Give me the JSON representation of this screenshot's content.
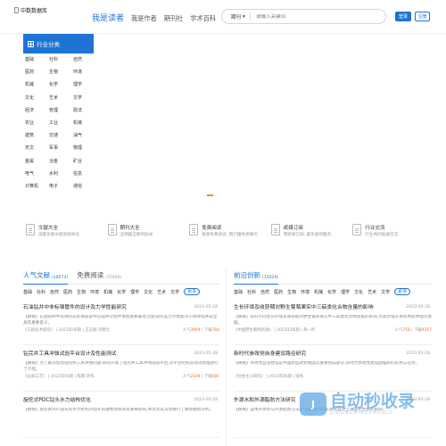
{
  "header": {
    "logo_text": "中数数据库",
    "nav": [
      "我是读者",
      "我是作者",
      "期刊社",
      "学术百科"
    ],
    "search_type": "期刊",
    "search_placeholder": "请输入关键词",
    "login": "登录",
    "register": "注册"
  },
  "categories": {
    "title": "行业分类",
    "items": [
      "基础",
      "社科",
      "自然",
      "医药",
      "生物",
      "环境",
      "机械",
      "化学",
      "理学",
      "文化",
      "艺术",
      "文学",
      "经济",
      "管理",
      "政法",
      "农业",
      "工业",
      "机械",
      "建筑",
      "交通",
      "油气",
      "天文",
      "军事",
      "物理",
      "金属",
      "冶金",
      "矿业",
      "电气",
      "水利",
      "信息",
      "计算机",
      "电子",
      "通信"
    ]
  },
  "features": [
    {
      "title": "文献大全",
      "desc": "海量优质文献资源阅读"
    },
    {
      "title": "期刊大全",
      "desc": "全网最全期刊收录"
    },
    {
      "title": "免费阅读",
      "desc": "极简免费阅读, 我们懂你想要的"
    },
    {
      "title": "纸媒订阅",
      "desc": "零距离订阅, 最优质的服务"
    },
    {
      "title": "行业交流",
      "desc": "行业共同发展交流"
    }
  ],
  "left_panel": {
    "tab_active": "人气文献",
    "tab_active_count": "(16572)",
    "tab_other": "免费阅读",
    "tab_other_count": "(75940)",
    "cats": [
      "基础",
      "社科",
      "自然",
      "医药",
      "生物",
      "环境",
      "机械",
      "化学",
      "理学",
      "文化",
      "艺术",
      "文学"
    ],
    "more": "更多",
    "articles": [
      {
        "title": "石油钻井中非标钢管件的设计及力学性能研究",
        "date": "2023-05-28",
        "abstract": "【摘要】石油钻井中常用的非标钢管部件在钻井过程中承担重要载荷,因此研究其力学性能对于保障钻井安全具有重要意义。",
        "source": "《工程技术研究》 | 2023年06期 | 王志刚 刘建华",
        "views": "3954",
        "downloads": "784"
      },
      {
        "title": "钻完井工具冲蚀试验平台设计及性能测试",
        "date": "2023-05-28",
        "abstract": "【摘要】为了解决现场钻完井工具冲蚀问题,研究开发了钻完井工具冲蚀试验平台,对平台结构及测试原理进行了介绍。",
        "source": "《钻采工艺》 | 2023年06期 | 陈鹏 李伟",
        "views": "2109",
        "downloads": "581"
      },
      {
        "title": "旋挖式PDC钻头水力结构优化",
        "date": "2023-05-28",
        "abstract": "【摘要】旋挖式PDC钻头的水力结构对钻头的破岩效率具有重要影响,本文对其流场进行了数值模拟分析。",
        "source": "",
        "views": "",
        "downloads": ""
      }
    ]
  },
  "right_panel": {
    "tab_active": "前沿创新",
    "tab_active_count": "(15029)",
    "cats": [
      "基础",
      "社科",
      "自然",
      "医药",
      "生物",
      "环境",
      "机械",
      "化学",
      "理学",
      "文化",
      "艺术",
      "文学"
    ],
    "more": "更多",
    "articles": [
      {
        "title": "生长环境及收获期对野生葡萄果实中三萜类化合物含量的影响",
        "date": "2023-05-28",
        "abstract": "【摘要】研究不同生长环境及收获期对野生葡萄果实中三萜类化合物含量的影响,为其合理开发利用提供理论依据。",
        "source": "《中国野生植物资源》 | 2023年06期 | 黄一鸣",
        "views": "716",
        "downloads": "4357"
      },
      {
        "title": "新时代参政党自身建设路径研究",
        "date": "2023-05-28",
        "abstract": "【摘要】参政党自身建设是中国新型政党制度的重要组成部分,新时代参政党建设面临新的形势与任务。",
        "source": "《社会主义研究》 | 2023年06期 | 张伟",
        "views": "",
        "downloads": ""
      },
      {
        "title": "外源水和外源脂防方法研究",
        "date": "2023-05-28",
        "abstract": "【摘要】运用外源水与外源脂防方法对土壤进行处理,研究其对土壤理化性质的影响。",
        "source": "",
        "views": "",
        "downloads": ""
      }
    ]
  },
  "labels": {
    "views": "人气",
    "downloads": "下载"
  },
  "watermark": {
    "badge": "J",
    "text": "自动秒收录",
    "sub": "ZIDONGMIAOSHOULU"
  },
  "colors": {
    "accent": "#1e74d4",
    "hot": "#f06a24"
  }
}
